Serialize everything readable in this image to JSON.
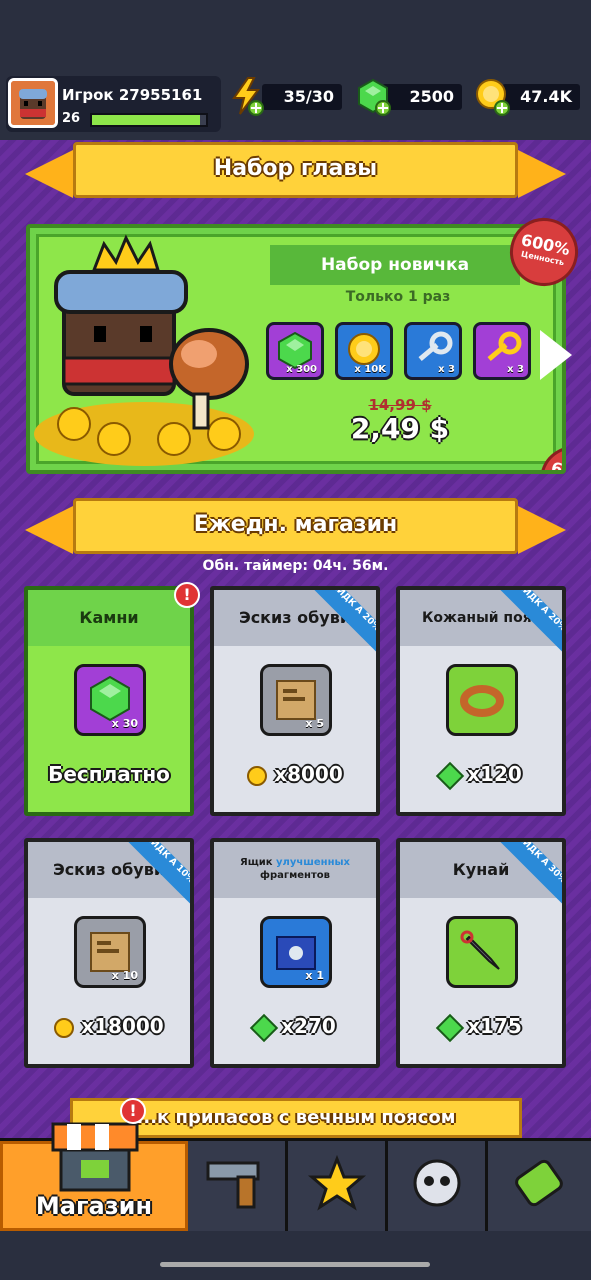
{
  "player": {
    "name": "Игрок 27955161",
    "level": "26",
    "xp_fraction": 0.95
  },
  "resources": {
    "energy": "35/30",
    "gems": "2500",
    "coins": "47.4K"
  },
  "chapter_pack": {
    "title": "Набор главы"
  },
  "starter": {
    "title": "Набор новичка",
    "limit": "Только 1 раз",
    "value_pct": "600%",
    "value_label": "Ценность",
    "items": [
      {
        "name": "gem-item-icon",
        "qty": "x 300",
        "color": "#a23fd6"
      },
      {
        "name": "coin-item-icon",
        "qty": "x 10K",
        "color": "#2a7ad8"
      },
      {
        "name": "silver-key-icon",
        "qty": "x 3",
        "color": "#2a7ad8"
      },
      {
        "name": "gold-key-icon",
        "qty": "x 3",
        "color": "#a23fd6"
      }
    ],
    "old_price": "14,99 $",
    "new_price": "2,49 $"
  },
  "daily_shop": {
    "title": "Ежедн. магазин",
    "timer": "Обн. таймер: 04ч. 56м.",
    "cards": [
      {
        "title": "Камни",
        "qty": "x 30",
        "price": "Бесплатно",
        "discount": "",
        "icon": "gem-icon"
      },
      {
        "title": "Эскиз обуви",
        "qty": "x 5",
        "price": "x8000",
        "discount": "СКИДК А 20%",
        "icon": "boots-blueprint-icon"
      },
      {
        "title": "Кожаный пояс",
        "qty": "",
        "price": "x120",
        "discount": "СКИДК А 20%",
        "icon": "leather-belt-icon"
      },
      {
        "title": "Эскиз обуви",
        "qty": "x 10",
        "price": "x18000",
        "discount": "СКИДК А 10%",
        "icon": "boots-blueprint-icon"
      },
      {
        "title_prefix": "Ящик ",
        "title_highlight": "улучшенных",
        "title_suffix": "фрагментов",
        "qty": "x 1",
        "price": "x270",
        "discount": "",
        "icon": "fragment-chest-icon"
      },
      {
        "title": "Кунай",
        "qty": "",
        "price": "x175",
        "discount": "СКИДК А 30%",
        "icon": "kunai-icon"
      }
    ]
  },
  "supply_banner": "...к припасов с вечным поясом",
  "nav": {
    "shop": "Магазин"
  },
  "colors": {
    "purple": "#5b2a8f",
    "gold": "#ffd23a",
    "green": "#8ee64a",
    "blue": "#2a8ad8"
  }
}
